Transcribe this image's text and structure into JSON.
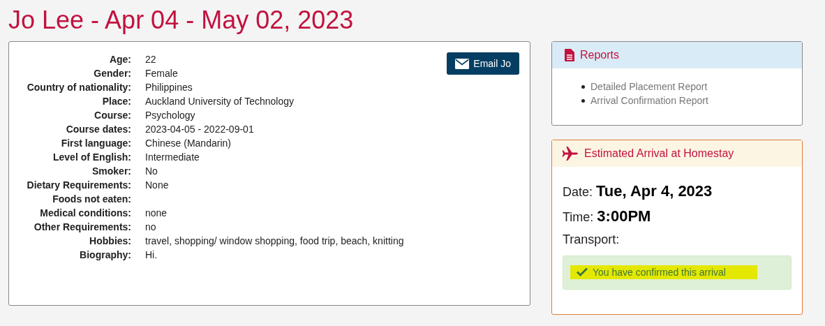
{
  "page_title": "Jo Lee - Apr 04 - May 02, 2023",
  "profile": {
    "email_button": "Email Jo",
    "fields": [
      {
        "label": "Age:",
        "value": "22"
      },
      {
        "label": "Gender:",
        "value": "Female"
      },
      {
        "label": "Country of nationality:",
        "value": "Philippines"
      },
      {
        "label": "Place:",
        "value": "Auckland University of Technology"
      },
      {
        "label": "Course:",
        "value": "Psychology"
      },
      {
        "label": "Course dates:",
        "value": "2023-04-05 - 2022-09-01"
      },
      {
        "label": "First language:",
        "value": "Chinese (Mandarin)"
      },
      {
        "label": "Level of English:",
        "value": "Intermediate"
      },
      {
        "label": "Smoker:",
        "value": "No"
      },
      {
        "label": "Dietary Requirements:",
        "value": "None"
      },
      {
        "label": "Foods not eaten:"
      },
      {
        "label": "Medical conditions:",
        "value": "none"
      },
      {
        "label": "Other Requirements:",
        "value": "no"
      },
      {
        "label": "Hobbies:",
        "value": "travel, shopping/ window shopping, food trip, beach, knitting"
      },
      {
        "label": "Biography:",
        "value": "Hi."
      }
    ]
  },
  "reports": {
    "title": "Reports",
    "links": [
      "Detailed Placement Report",
      "Arrival Confirmation Report"
    ]
  },
  "arrival": {
    "title": "Estimated Arrival at Homestay",
    "date_label": "Date:",
    "date": "Tue, Apr 4, 2023",
    "time_label": "Time:",
    "time": "3:00PM",
    "transport_label": "Transport:",
    "confirmation": {
      "text": "You have confirmed this arrival",
      "highlighted": true
    }
  }
}
